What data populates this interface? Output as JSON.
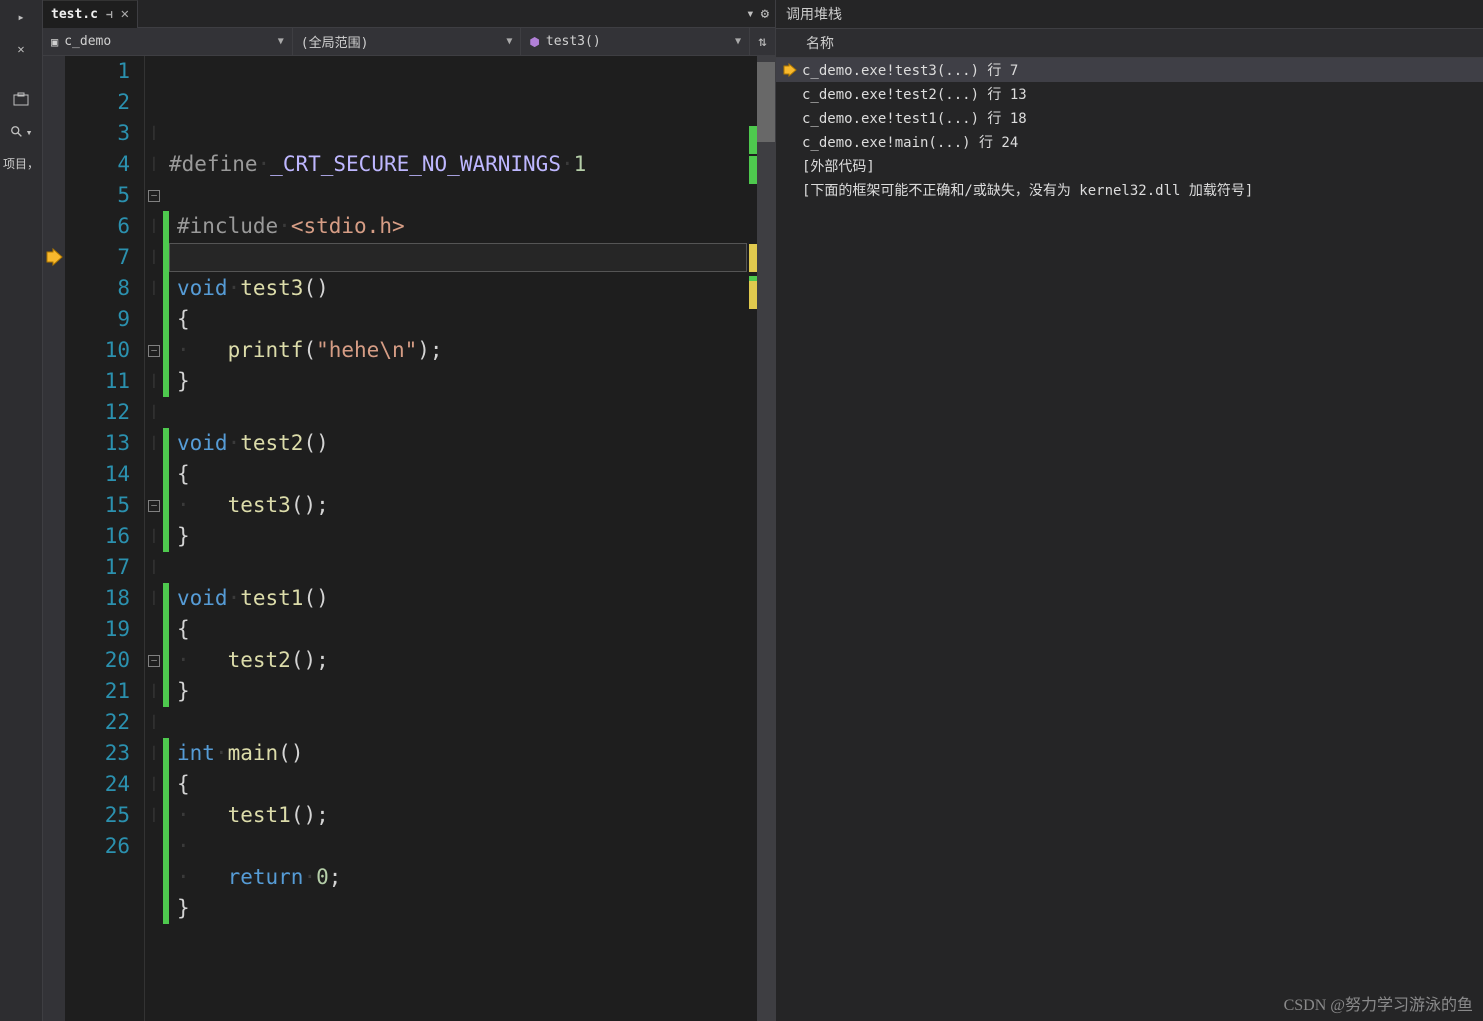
{
  "left_sidebar": {
    "pin_icon": "📌",
    "close_icon": "✕",
    "search_placeholder": "",
    "project_label_truncated": "项目，"
  },
  "tab": {
    "filename": "test.c",
    "pin_tooltip": "pin",
    "close_tooltip": "close"
  },
  "combos": {
    "project": "c_demo",
    "scope": "(全局范围)",
    "member": "test3()"
  },
  "code_lines": [
    {
      "n": 1,
      "fold": "",
      "html": "<span class='macro'>#define</span>·<span class='def'>_CRT_SECURE_NO_WARNINGS</span>·<span class='num'>1</span>"
    },
    {
      "n": 2,
      "fold": "",
      "html": ""
    },
    {
      "n": 3,
      "fold": "",
      "green": true,
      "html": "<span class='macro'>#include</span>·<span class='str'>&lt;stdio.h&gt;</span>"
    },
    {
      "n": 4,
      "fold": "",
      "green": true,
      "html": ""
    },
    {
      "n": 5,
      "fold": "-",
      "green": true,
      "html": "<span class='kw'>void</span>·<span class='fn'>test3</span><span class='punct'>()</span>"
    },
    {
      "n": 6,
      "fold": "",
      "green": true,
      "html": "<span class='punct'>{</span>"
    },
    {
      "n": 7,
      "fold": "",
      "green": true,
      "bp": true,
      "current": true,
      "html": "<span class='guide'>·</span>   <span class='fn'>printf</span><span class='punct'>(</span><span class='str'>\"hehe\\n\"</span><span class='punct'>);</span>"
    },
    {
      "n": 8,
      "fold": "",
      "green": true,
      "html": "<span class='punct'>}</span>"
    },
    {
      "n": 9,
      "fold": "",
      "html": ""
    },
    {
      "n": 10,
      "fold": "-",
      "green": true,
      "html": "<span class='kw'>void</span>·<span class='fn'>test2</span><span class='punct'>()</span>"
    },
    {
      "n": 11,
      "fold": "",
      "green": true,
      "html": "<span class='punct'>{</span>"
    },
    {
      "n": 12,
      "fold": "",
      "green": true,
      "html": "<span class='guide'>·</span>   <span class='fn'>test3</span><span class='punct'>();</span>"
    },
    {
      "n": 13,
      "fold": "",
      "green": true,
      "html": "<span class='punct'>}</span>"
    },
    {
      "n": 14,
      "fold": "",
      "html": ""
    },
    {
      "n": 15,
      "fold": "-",
      "green": true,
      "html": "<span class='kw'>void</span>·<span class='fn'>test1</span><span class='punct'>()</span>"
    },
    {
      "n": 16,
      "fold": "",
      "green": true,
      "html": "<span class='punct'>{</span>"
    },
    {
      "n": 17,
      "fold": "",
      "green": true,
      "html": "<span class='guide'>·</span>   <span class='fn'>test2</span><span class='punct'>();</span>"
    },
    {
      "n": 18,
      "fold": "",
      "green": true,
      "html": "<span class='punct'>}</span>"
    },
    {
      "n": 19,
      "fold": "",
      "html": ""
    },
    {
      "n": 20,
      "fold": "-",
      "green": true,
      "html": "<span class='kw'>int</span>·<span class='fn'>main</span><span class='punct'>()</span>"
    },
    {
      "n": 21,
      "fold": "",
      "green": true,
      "html": "<span class='punct'>{</span>"
    },
    {
      "n": 22,
      "fold": "",
      "green": true,
      "html": "<span class='guide'>·</span>   <span class='fn'>test1</span><span class='punct'>();</span>"
    },
    {
      "n": 23,
      "fold": "",
      "green": true,
      "html": "<span class='guide'>·</span>"
    },
    {
      "n": 24,
      "fold": "",
      "green": true,
      "html": "<span class='guide'>·</span>   <span class='kw'>return</span>·<span class='num'>0</span><span class='punct'>;</span>"
    },
    {
      "n": 25,
      "fold": "",
      "green": true,
      "html": "<span class='punct'>}</span>"
    },
    {
      "n": 26,
      "fold": "",
      "html": ""
    }
  ],
  "callstack": {
    "panel_title": "调用堆栈",
    "header": "名称",
    "frames": [
      {
        "active": true,
        "text": "c_demo.exe!test3(...) 行 7"
      },
      {
        "active": false,
        "text": "c_demo.exe!test2(...) 行 13"
      },
      {
        "active": false,
        "text": "c_demo.exe!test1(...) 行 18"
      },
      {
        "active": false,
        "text": "c_demo.exe!main(...) 行 24"
      },
      {
        "active": false,
        "text": "[外部代码]"
      },
      {
        "active": false,
        "text": "[下面的框架可能不正确和/或缺失，没有为 kernel32.dll 加载符号]"
      }
    ]
  },
  "watermark": "CSDN @努力学习游泳的鱼"
}
